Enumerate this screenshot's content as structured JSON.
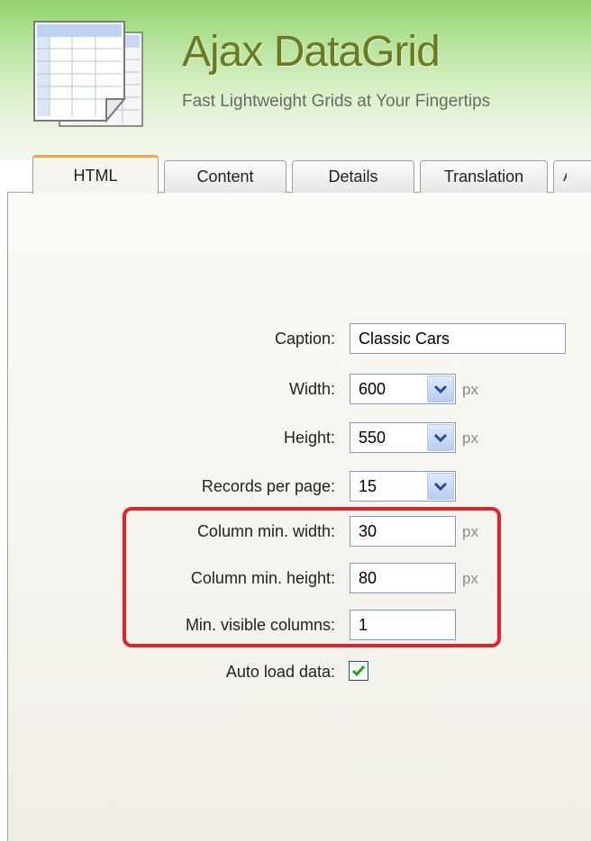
{
  "header": {
    "title": "Ajax DataGrid",
    "subtitle": "Fast Lightweight Grids at Your Fingertips"
  },
  "tabs": [
    {
      "label": "HTML",
      "active": true
    },
    {
      "label": "Content",
      "active": false
    },
    {
      "label": "Details",
      "active": false
    },
    {
      "label": "Translation",
      "active": false
    },
    {
      "label": "A",
      "active": false
    }
  ],
  "form": {
    "caption": {
      "label": "Caption:",
      "value": "Classic Cars"
    },
    "width": {
      "label": "Width:",
      "value": "600",
      "unit": "px"
    },
    "height": {
      "label": "Height:",
      "value": "550",
      "unit": "px"
    },
    "records_per_page": {
      "label": "Records per page:",
      "value": "15"
    },
    "column_min_width": {
      "label": "Column min. width:",
      "value": "30",
      "unit": "px"
    },
    "column_min_height": {
      "label": "Column min. height:",
      "value": "80",
      "unit": "px"
    },
    "min_visible_columns": {
      "label": "Min. visible columns:",
      "value": "1"
    },
    "auto_load_data": {
      "label": "Auto load data:",
      "checked": true
    }
  },
  "colors": {
    "accent_tab": "#f2a63a",
    "highlight": "#e0242a",
    "title": "#6b7a1e",
    "header_green": "#8fd36b"
  },
  "icons": {
    "logo": "spreadsheet-pages-icon",
    "dropdown": "chevron-down-icon",
    "check": "checkmark-icon"
  }
}
